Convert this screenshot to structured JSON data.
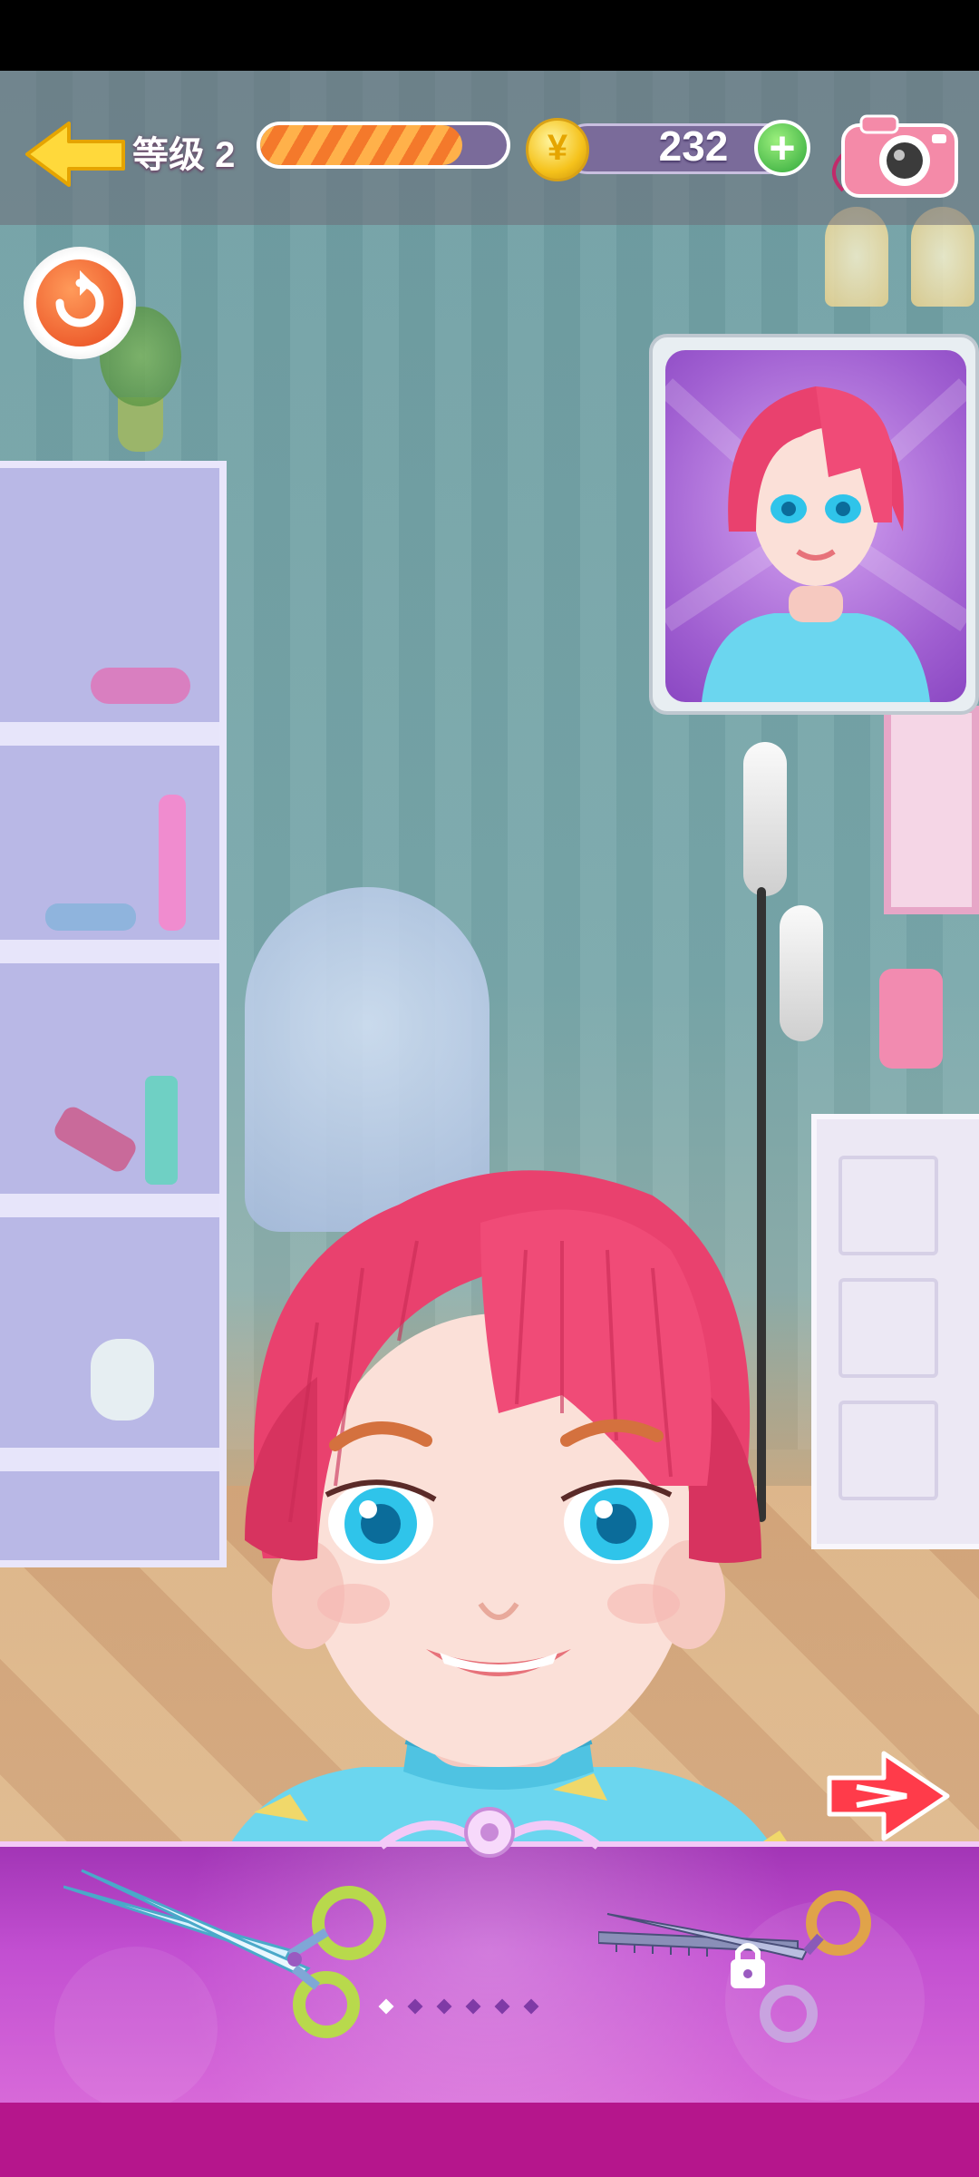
{
  "hud": {
    "level_label": "等级 2",
    "level_progress": 0.82,
    "coins": "232"
  },
  "icons": {
    "back": "back-arrow-icon",
    "coin": "yen-coin-icon",
    "add_coins": "plus-icon",
    "camera": "camera-icon",
    "reset": "reset-icon",
    "next": "next-arrow-icon",
    "lock": "lock-icon"
  },
  "colors": {
    "hair": "#e9416e",
    "panel": "#c24fd1",
    "coin": "#f5c21b",
    "plus": "#2fa73a",
    "reset": "#e8491e"
  },
  "tools": {
    "pager_count": 6,
    "active_index": 0,
    "items": [
      {
        "name": "scissors",
        "locked": false
      },
      {
        "name": "thinning-scissors",
        "locked": true
      }
    ]
  }
}
